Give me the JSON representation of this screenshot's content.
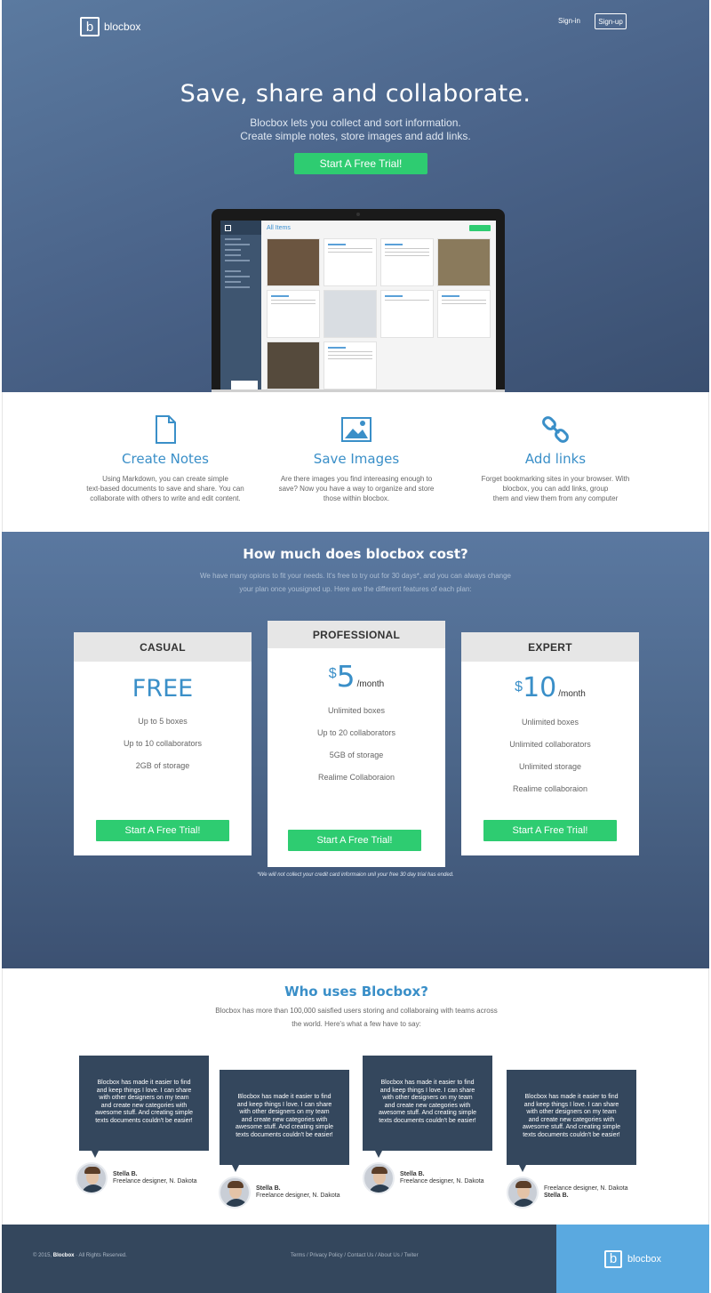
{
  "header": {
    "logo_letter": "b",
    "logo_text": "blocbox",
    "signin": "Sign-in",
    "signup": "Sign-up"
  },
  "hero": {
    "title": "Save, share and collaborate.",
    "subtitle_line1": "Blocbox lets you collect and sort information.",
    "subtitle_line2": "Create simple notes, store images and add links.",
    "cta": "Start A Free Trial!",
    "app_preview": {
      "title": "All Items"
    }
  },
  "features": [
    {
      "icon": "document-icon",
      "title": "Create Notes",
      "desc_lines": [
        "Using Markdown, you can create simple",
        "text-based documents to save and share. You can",
        "collaborate with others to write and edit content."
      ]
    },
    {
      "icon": "image-icon",
      "title": "Save Images",
      "desc_lines": [
        "Are there images you find intereasing enough to",
        "save? Now you have a way to organize and store",
        "those within blocbox."
      ]
    },
    {
      "icon": "link-icon",
      "title": "Add links",
      "desc_lines": [
        "Forget bookmarking sites in your browser. With",
        "blocbox, you can add links, group",
        "them and view them from any computer"
      ]
    }
  ],
  "pricing": {
    "title": "How much does blocbox cost?",
    "subtitle_line1": "We have many opions to fit your needs. It's free to try out for 30 days*, and you can always change",
    "subtitle_line2": "your plan once yousigned up. Here are the different features of each plan:",
    "plans": [
      {
        "name": "CASUAL",
        "price": "FREE",
        "features": [
          "Up to 5 boxes",
          "Up to 10 collaborators",
          "2GB of storage"
        ],
        "cta": "Start A Free Trial!"
      },
      {
        "name": "PROFESSIONAL",
        "currency": "$",
        "amount": "5",
        "period": "/month",
        "features": [
          "Unlimited boxes",
          "Up to 20 collaborators",
          "5GB of storage",
          "Realime Collaboraion"
        ],
        "cta": "Start A Free Trial!"
      },
      {
        "name": "EXPERT",
        "currency": "$",
        "amount": "10",
        "period": "/month",
        "features": [
          "Unlimited boxes",
          "Unlimited collaborators",
          "Unlimited storage",
          "Realime collaboraion"
        ],
        "cta": "Start A Free Trial!"
      }
    ],
    "note": "*We will not collect your credit card informaion unil your free 30 day trial has ended."
  },
  "testimonials": {
    "title": "Who uses Blocbox?",
    "subtitle_line1": "Blocbox has more than 100,000 saisfied users storing and collaboraing with teams across",
    "subtitle_line2": "the world. Here's what a few have to say:",
    "quote_lines": [
      "Blocbox has made it easier to find",
      "and keep things I love. I can share",
      "with other designers on my team",
      "and create new categories with",
      "awesome stuff. And creating simple",
      "texts documents couldn't be easier!"
    ],
    "items": [
      {
        "name": "Stella B.",
        "role": "Freelance designer, N. Dakota"
      },
      {
        "name": "Stella B.",
        "role": "Freelance designer, N. Dakota"
      },
      {
        "name": "Stella B.",
        "role": "Freelance designer, N. Dakota"
      },
      {
        "name": "Stella B.",
        "role": "Freelance designer, N. Dakota"
      }
    ]
  },
  "footer": {
    "copyright_prefix": "© 2015,",
    "copyright_brand": "Blocbox",
    "copyright_suffix": "· All Rights Reserved.",
    "links": "Terms / Privacy Policy / Contact Us / About Us / Twiter",
    "logo_letter": "b",
    "logo_text": "blocbox"
  },
  "colors": {
    "accent_blue": "#3a8fc8",
    "cta_green": "#2ecc71",
    "hero_blue": "#4a6389",
    "dark_navy": "#34475d",
    "footer_brand_blue": "#5aa9e0"
  }
}
